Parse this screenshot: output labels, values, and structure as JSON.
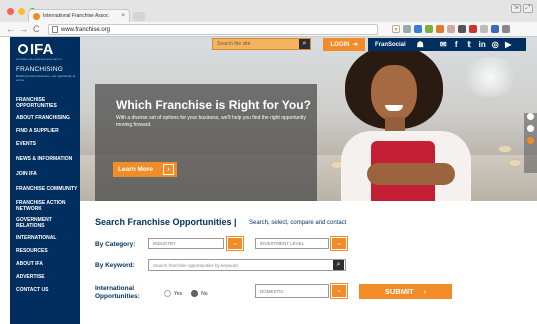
{
  "browser": {
    "tab_title": "International Franchise Assoc",
    "tab_close": "×",
    "url": "www.franchise.org",
    "nav": {
      "back": "←",
      "forward": "→",
      "reload": "C"
    },
    "window_controls": [
      "⇲",
      "⤢"
    ]
  },
  "header": {
    "search_placeholder": "Search the site",
    "search_icon": "search-icon",
    "login_label": "LOGIN",
    "login_icon": "login-arrow-icon",
    "fransocial_label": "FranSocial",
    "social_icons": [
      "mail-icon",
      "facebook-icon",
      "twitter-icon",
      "linkedin-icon",
      "instagram-icon",
      "youtube-icon"
    ]
  },
  "logo": {
    "mark": "IFA",
    "small": "INTERNATIONAL FRANCHISE ASSOCIATION",
    "franchising": "FRANCHISING",
    "tagline": "Building local businesses, one opportunity at a time."
  },
  "sidebar": {
    "items": [
      {
        "label": "FRANCHISE OPPORTUNITIES"
      },
      {
        "label": "ABOUT FRANCHISING"
      },
      {
        "label": "FIND A SUPPLIER"
      },
      {
        "label": "EVENTS"
      },
      {
        "label": "NEWS & INFORMATION"
      },
      {
        "label": "JOIN IFA"
      },
      {
        "label": "FRANCHISE COMMUNITY"
      },
      {
        "label": "FRANCHISE ACTION NETWORK"
      },
      {
        "label": "GOVERNMENT RELATIONS"
      },
      {
        "label": "INTERNATIONAL"
      },
      {
        "label": "RESOURCES"
      },
      {
        "label": "ABOUT IFA"
      },
      {
        "label": "ADVERTISE"
      },
      {
        "label": "CONTACT US"
      }
    ]
  },
  "hero": {
    "title": "Which Franchise is Right for You?",
    "text": "With a diverse set of options for your business, we'll help you find the right opportunity moving forward.",
    "button_label": "Learn More",
    "button_arrow": "›",
    "slider_dots": [
      "inactive",
      "inactive",
      "active"
    ]
  },
  "search": {
    "title": "Search Franchise Opportunities |",
    "subtitle": "Search, select, compare and contact",
    "category_label": "By Category:",
    "industry_value": "INDUSTRY",
    "investment_value": "INVESTMENT LEVEL",
    "keyword_label": "By Keyword:",
    "keyword_placeholder": "Search franchise opportunities by keyword",
    "intl_label_1": "International",
    "intl_label_2": "Opportunities:",
    "yes_label": "Yes",
    "no_label": "No",
    "intl_selected": "No",
    "domestic_value": "DOMESTIC",
    "submit_label": "SUBMIT",
    "submit_arrow": "›"
  },
  "colors": {
    "navy": "#002f5f",
    "orange": "#f28c28"
  }
}
